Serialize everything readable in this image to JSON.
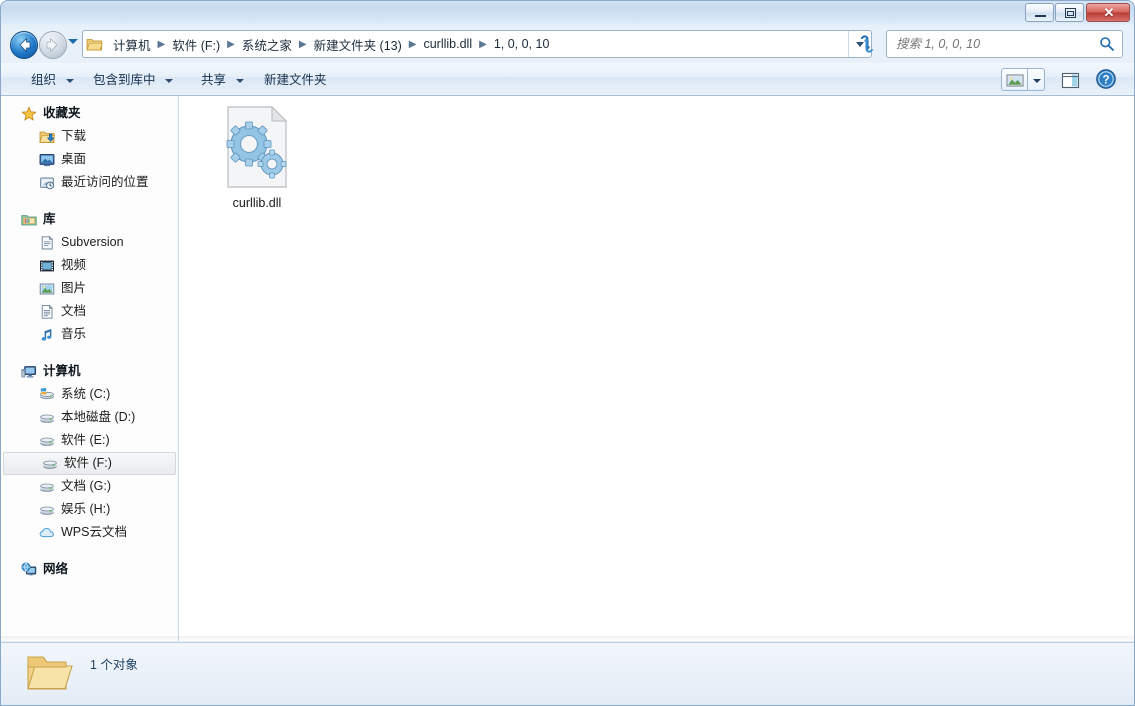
{
  "window": {
    "controls": {
      "minimize": "minimize-button",
      "maximize": "restore-button",
      "close_label": "✕"
    }
  },
  "address_bar": {
    "back_tooltip": "后退",
    "forward_tooltip": "前进",
    "breadcrumbs": [
      {
        "label": "计算机"
      },
      {
        "label": "软件 (F:)"
      },
      {
        "label": "系统之家"
      },
      {
        "label": "新建文件夹 (13)"
      },
      {
        "label": "curllib.dll"
      },
      {
        "label": "1, 0, 0, 10"
      }
    ],
    "separator": "▶",
    "refresh_icon": "refresh-icon"
  },
  "search": {
    "placeholder": "搜索 1, 0, 0, 10",
    "value": "",
    "icon": "search-icon"
  },
  "toolbar": {
    "organize_label": "组织",
    "include_library_label": "包含到库中",
    "share_label": "共享",
    "new_folder_label": "新建文件夹",
    "views_icon": "views-icon",
    "preview_pane_icon": "preview-pane-icon",
    "help_icon": "help-icon"
  },
  "sidebar": {
    "sections": [
      {
        "root": {
          "label": "收藏夹",
          "icon": "star-icon"
        },
        "items": [
          {
            "label": "下载",
            "icon": "downloads-icon"
          },
          {
            "label": "桌面",
            "icon": "desktop-icon"
          },
          {
            "label": "最近访问的位置",
            "icon": "recent-places-icon"
          }
        ]
      },
      {
        "root": {
          "label": "库",
          "icon": "library-icon"
        },
        "items": [
          {
            "label": "Subversion",
            "icon": "subversion-icon"
          },
          {
            "label": "视频",
            "icon": "video-icon"
          },
          {
            "label": "图片",
            "icon": "pictures-icon"
          },
          {
            "label": "文档",
            "icon": "documents-icon"
          },
          {
            "label": "音乐",
            "icon": "music-icon"
          }
        ]
      },
      {
        "root": {
          "label": "计算机",
          "icon": "computer-icon"
        },
        "items": [
          {
            "label": "系统 (C:)",
            "icon": "system-drive-icon",
            "selected": false
          },
          {
            "label": "本地磁盘 (D:)",
            "icon": "drive-icon",
            "selected": false
          },
          {
            "label": "软件 (E:)",
            "icon": "drive-icon",
            "selected": false
          },
          {
            "label": "软件 (F:)",
            "icon": "drive-icon",
            "selected": true
          },
          {
            "label": "文档 (G:)",
            "icon": "drive-icon",
            "selected": false
          },
          {
            "label": "娱乐 (H:)",
            "icon": "drive-icon",
            "selected": false
          },
          {
            "label": "WPS云文档",
            "icon": "cloud-icon",
            "selected": false
          }
        ]
      },
      {
        "root": {
          "label": "网络",
          "icon": "network-icon"
        },
        "items": []
      }
    ]
  },
  "content": {
    "files": [
      {
        "name": "curllib.dll",
        "icon": "dll-file-icon"
      }
    ]
  },
  "status_bar": {
    "text": "1 个对象",
    "icon": "open-folder-icon"
  },
  "colors": {
    "accent": "#1e78c8",
    "frame": "#d3e3f3",
    "close_button": "#b83c36",
    "text": "#1c1c1c"
  }
}
